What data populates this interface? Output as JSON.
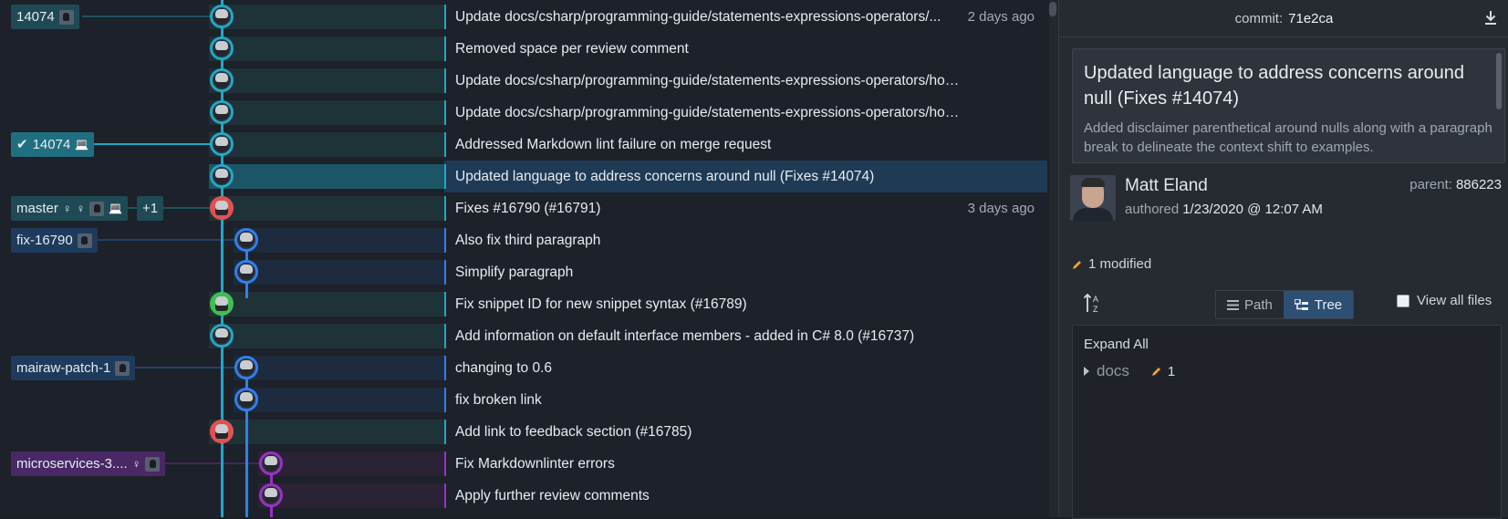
{
  "graph": {
    "rows": [
      {
        "message": "Update docs/csharp/programming-guide/statements-expressions-operators/...",
        "when": "2 days ago",
        "lane": "cyan",
        "node_color": "#1fa8c7",
        "branch_label": "14074",
        "label_icons": [
          "avatar"
        ]
      },
      {
        "message": "Removed space per review comment",
        "when": "",
        "lane": "cyan",
        "node_color": "#1fa8c7"
      },
      {
        "message": "Update docs/csharp/programming-guide/statements-expressions-operators/how-to-de...",
        "when": "",
        "lane": "cyan",
        "node_color": "#1fa8c7"
      },
      {
        "message": "Update docs/csharp/programming-guide/statements-expressions-operators/how-to-de...",
        "when": "",
        "lane": "cyan",
        "node_color": "#1fa8c7"
      },
      {
        "message": "Addressed Markdown lint failure on merge request",
        "when": "",
        "lane": "cyan",
        "node_color": "#1fa8c7",
        "branch_label": "14074",
        "label_check": true,
        "label_icons": [
          "laptop"
        ]
      },
      {
        "message": "Updated language to address concerns around null (Fixes #14074)",
        "when": "",
        "lane": "cyan",
        "node_color": "#1fa8c7",
        "selected": true
      },
      {
        "message": "Fixes #16790 (#16791)",
        "when": "3 days ago",
        "lane": "cyan",
        "node_color": "#e05252",
        "branch_label": "master",
        "label_icons": [
          "person",
          "person",
          "avatar",
          "laptop"
        ],
        "extra": "+1"
      },
      {
        "message": "Also fix third paragraph",
        "when": "",
        "lane": "blue",
        "node_color": "#2f80ed",
        "branch_label": "fix-16790",
        "label_icons": [
          "avatar"
        ]
      },
      {
        "message": "Simplify paragraph",
        "when": "",
        "lane": "blue",
        "node_color": "#2f80ed"
      },
      {
        "message": "Fix snippet ID for new snippet syntax (#16789)",
        "when": "",
        "lane": "cyan",
        "node_color": "#3fbf4f"
      },
      {
        "message": "Add information on default interface members - added in C# 8.0 (#16737)",
        "when": "",
        "lane": "cyan",
        "node_color": "#1fa8c7"
      },
      {
        "message": "changing to 0.6",
        "when": "",
        "lane": "blue",
        "node_color": "#2f80ed",
        "branch_label": "mairaw-patch-1",
        "label_icons": [
          "avatar"
        ]
      },
      {
        "message": "fix broken link",
        "when": "",
        "lane": "blue",
        "node_color": "#2f80ed"
      },
      {
        "message": "Add link to feedback section (#16785)",
        "when": "",
        "lane": "cyan",
        "node_color": "#e05252"
      },
      {
        "message": "Fix Markdownlinter errors",
        "when": "",
        "lane": "purple",
        "node_color": "#9b2fc7",
        "branch_label": "microservices-3....",
        "label_icons": [
          "person",
          "avatar"
        ]
      },
      {
        "message": "Apply further review comments",
        "when": "",
        "lane": "purple",
        "node_color": "#9b2fc7"
      }
    ]
  },
  "panel": {
    "commit_label": "commit:",
    "commit_sha": "71e2ca",
    "download_icon": "download-icon",
    "message_title": "Updated language to address concerns around null (Fixes #14074)",
    "message_body": "Added disclaimer parenthetical around nulls along with a paragraph break to delineate the context shift to examples.",
    "author_name": "Matt Eland",
    "authored_label": "authored",
    "authored_date": "1/23/2020 @ 12:07 AM",
    "parent_label": "parent:",
    "parent_sha": "886223",
    "modified": "1 modified",
    "view_path": "Path",
    "view_tree": "Tree",
    "view_all_files": "View all files",
    "expand_all": "Expand All",
    "tree_items": [
      {
        "name": "docs",
        "modified_count": "1"
      }
    ]
  },
  "colors": {
    "cyan": "#1fa8c7",
    "blue": "#2f80ed",
    "purple": "#9b2fc7",
    "red": "#e05252",
    "green": "#3fbf4f",
    "selected_row": "#1f3a55",
    "accent": "#2d4f74"
  }
}
